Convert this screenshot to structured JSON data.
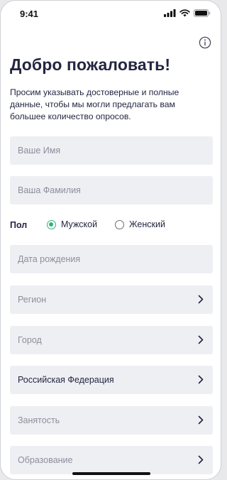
{
  "status": {
    "time": "9:41"
  },
  "header": {
    "title": "Добро пожаловать!",
    "subtitle": "Просим указывать достоверные и полные данные, чтобы мы могли предлагать вам большее количество опросов."
  },
  "form": {
    "first_name_placeholder": "Ваше Имя",
    "last_name_placeholder": "Ваша Фамилия",
    "gender": {
      "label": "Пол",
      "options": [
        "Мужской",
        "Женский"
      ],
      "selected": "Мужской"
    },
    "birthdate_placeholder": "Дата рождения",
    "region_placeholder": "Регион",
    "city_placeholder": "Город",
    "country_value": "Российская Федерация",
    "employment_placeholder": "Занятость",
    "education_placeholder": "Образование"
  },
  "colors": {
    "accent": "#2fb37a",
    "text": "#232640",
    "field_bg": "#eeeff3",
    "placeholder": "#8b8e9c"
  },
  "icons": [
    "cellular-signal-icon",
    "wifi-icon",
    "battery-icon",
    "info-icon",
    "chevron-right-icon"
  ]
}
